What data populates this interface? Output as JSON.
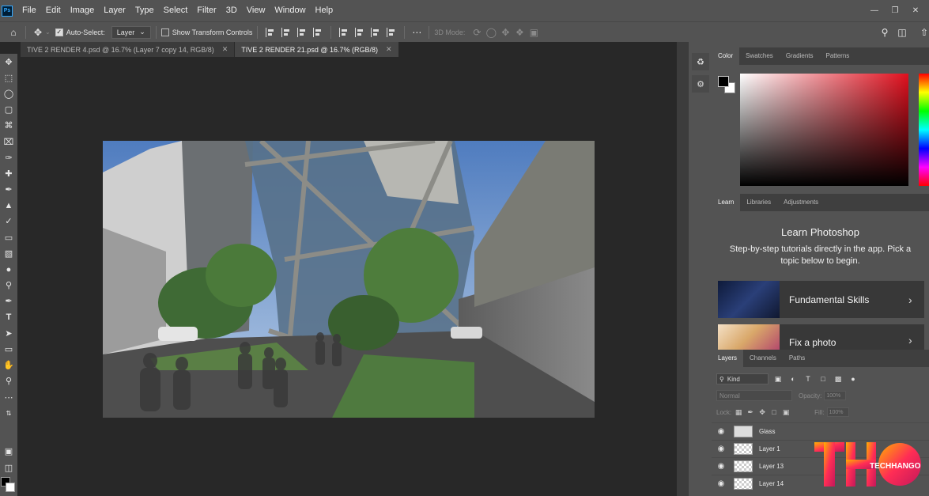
{
  "menu": [
    "File",
    "Edit",
    "Image",
    "Layer",
    "Type",
    "Select",
    "Filter",
    "3D",
    "View",
    "Window",
    "Help"
  ],
  "options": {
    "auto_select_label": "Auto-Select:",
    "auto_select_value": "Layer",
    "show_transform_label": "Show Transform Controls",
    "mode_3d_label": "3D Mode:"
  },
  "tabs": [
    {
      "label": "TIVE 2 RENDER 4.psd @ 16.7% (Layer 7 copy 14, RGB/8)",
      "active": false
    },
    {
      "label": "TIVE 2 RENDER 21.psd @ 16.7% (RGB/8)",
      "active": true
    }
  ],
  "color_panel": {
    "tabs": [
      "Color",
      "Swatches",
      "Gradients",
      "Patterns"
    ],
    "foreground": "#000000",
    "background": "#ffffff"
  },
  "learn_panel": {
    "tabs": [
      "Learn",
      "Libraries",
      "Adjustments"
    ],
    "title": "Learn Photoshop",
    "description": "Step-by-step tutorials directly in the app. Pick a topic below to begin.",
    "cards": [
      "Fundamental Skills",
      "Fix a photo"
    ]
  },
  "layers_panel": {
    "tabs": [
      "Layers",
      "Channels",
      "Paths"
    ],
    "kind_label": "Kind",
    "blend_mode": "Normal",
    "opacity_label": "Opacity:",
    "opacity_value": "100%",
    "lock_label": "Lock:",
    "fill_label": "Fill:",
    "fill_value": "100%",
    "layers": [
      "Glass",
      "Layer 1",
      "Layer 13",
      "Layer 14"
    ]
  },
  "watermark": {
    "brand": "TECHHANGOUT",
    "mark": "THO"
  }
}
